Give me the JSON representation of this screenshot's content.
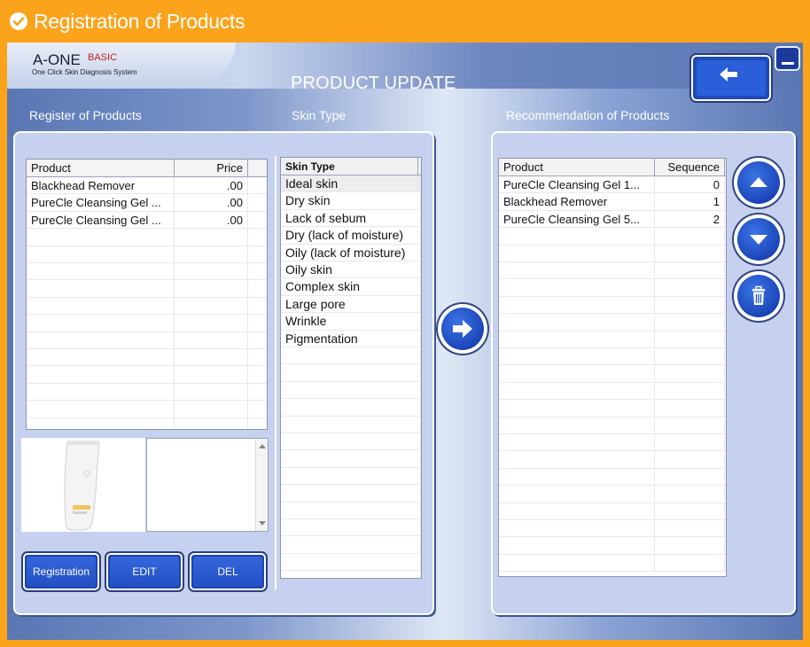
{
  "titlebar": {
    "title": "Registration of Products",
    "icon": "check-circle-icon"
  },
  "logo": {
    "main": "A-ONE",
    "badge": "BASIC",
    "subtitle": "One Click Skin Diagnosis System"
  },
  "page": {
    "heading": "PRODUCT UPDATE"
  },
  "sections": {
    "register": "Register of Products",
    "skin": "Skin Type",
    "recommend": "Recommendation of Products"
  },
  "products": {
    "columns": [
      "Product",
      "Price"
    ],
    "rows": [
      [
        "Blackhead Remover",
        ".00"
      ],
      [
        "PureCle Cleansing Gel ...",
        ".00"
      ],
      [
        "PureCle Cleansing Gel ...",
        ".00"
      ]
    ]
  },
  "skin_types": {
    "header": "Skin Type",
    "selected_index": 0,
    "items": [
      "Ideal skin",
      "Dry skin",
      "Lack of sebum",
      "Dry (lack of moisture)",
      "Oily (lack of moisture)",
      "Oily skin",
      "Complex skin",
      "Large pore",
      "Wrinkle",
      "Pigmentation"
    ]
  },
  "recommendations": {
    "columns": [
      "Product",
      "Sequence"
    ],
    "rows": [
      [
        "PureCle Cleansing Gel 1...",
        "0"
      ],
      [
        "Blackhead Remover",
        "1"
      ],
      [
        "PureCle Cleansing Gel 5...",
        "2"
      ]
    ]
  },
  "buttons": {
    "registration": "Registration",
    "edit": "EDIT",
    "del": "DEL"
  },
  "icons": {
    "back": "arrow-left-icon",
    "add": "arrow-right-icon",
    "up": "arrow-up-icon",
    "down": "arrow-down-icon",
    "delete": "trash-icon",
    "minimize": "minimize-icon"
  },
  "colors": {
    "accent": "#fca31c",
    "button_blue": "#2350c4"
  }
}
